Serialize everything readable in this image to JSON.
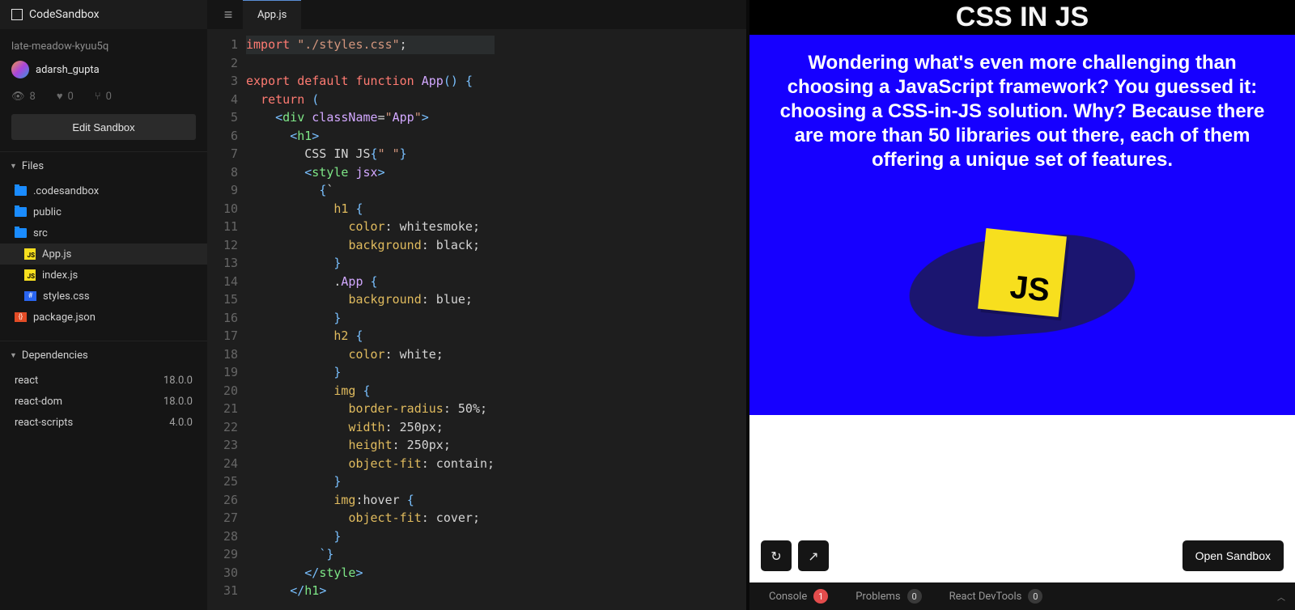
{
  "app_title": "CodeSandbox",
  "project": {
    "name": "late-meadow-kyuu5q",
    "author": "adarsh_gupta",
    "views": "8",
    "likes": "0",
    "forks": "0",
    "edit_label": "Edit Sandbox"
  },
  "sections": {
    "files_label": "Files",
    "deps_label": "Dependencies"
  },
  "files": [
    {
      "name": ".codesandbox",
      "type": "folder",
      "depth": 0
    },
    {
      "name": "public",
      "type": "folder",
      "depth": 0
    },
    {
      "name": "src",
      "type": "folder",
      "depth": 0
    },
    {
      "name": "App.js",
      "type": "js",
      "depth": 1,
      "active": true
    },
    {
      "name": "index.js",
      "type": "js",
      "depth": 1
    },
    {
      "name": "styles.css",
      "type": "css",
      "depth": 1
    },
    {
      "name": "package.json",
      "type": "json",
      "depth": 0
    }
  ],
  "deps": [
    {
      "name": "react",
      "version": "18.0.0"
    },
    {
      "name": "react-dom",
      "version": "18.0.0"
    },
    {
      "name": "react-scripts",
      "version": "4.0.0"
    }
  ],
  "tab": {
    "name": "App.js"
  },
  "code_lines": [
    "import \"./styles.css\";",
    "",
    "export default function App() {",
    "  return (",
    "    <div className=\"App\">",
    "      <h1>",
    "        CSS IN JS{\" \"}",
    "        <style jsx>",
    "          {`",
    "            h1 {",
    "              color: whitesmoke;",
    "              background: black;",
    "            }",
    "            .App {",
    "              background: blue;",
    "            }",
    "            h2 {",
    "              color: white;",
    "            }",
    "            img {",
    "              border-radius: 50%;",
    "              width: 250px;",
    "              height: 250px;",
    "              object-fit: contain;",
    "            }",
    "            img:hover {",
    "              object-fit: cover;",
    "            }",
    "          `}",
    "        </style>",
    "      </h1>"
  ],
  "preview": {
    "title": "CSS IN JS",
    "body": "Wondering what's even more challenging than choosing a JavaScript framework? You guessed it: choosing a CSS-in-JS solution. Why? Because there are more than 50 libraries out there, each of them offering a unique set of features.",
    "logo": "JS",
    "open_label": "Open Sandbox"
  },
  "bottom": {
    "console": "Console",
    "console_badge": "1",
    "problems": "Problems",
    "problems_badge": "0",
    "react": "React DevTools",
    "react_badge": "0"
  }
}
